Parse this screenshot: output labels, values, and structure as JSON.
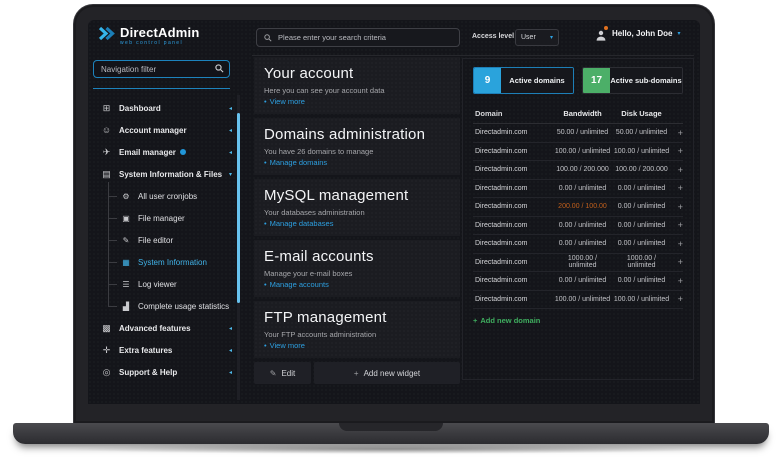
{
  "header": {
    "logo_title": "DirectAdmin",
    "logo_subtitle": "web control panel",
    "search_placeholder": "Please enter your search criteria",
    "access_level_label": "Access level",
    "access_level_value": "User",
    "greeting": "Hello, John Doe"
  },
  "sidebar": {
    "filter_placeholder": "Navigation filter",
    "top_items": [
      {
        "label": "Dashboard",
        "icon": "dashboard"
      },
      {
        "label": "Account manager",
        "icon": "account"
      },
      {
        "label": "Email manager",
        "icon": "email",
        "badge": true
      },
      {
        "label": "System Information & Files",
        "icon": "files",
        "expanded": true
      }
    ],
    "sub_items": [
      {
        "label": "All user cronjobs",
        "icon": "cronjobs"
      },
      {
        "label": "File manager",
        "icon": "folder"
      },
      {
        "label": "File editor",
        "icon": "editor"
      },
      {
        "label": "System Information",
        "icon": "sysinfo",
        "active": true
      },
      {
        "label": "Log viewer",
        "icon": "log"
      },
      {
        "label": "Complete usage statistics",
        "icon": "stats"
      }
    ],
    "bottom_items": [
      {
        "label": "Advanced features",
        "icon": "advanced"
      },
      {
        "label": "Extra features",
        "icon": "extra"
      },
      {
        "label": "Support & Help",
        "icon": "support"
      }
    ]
  },
  "widgets": [
    {
      "title": "Your account",
      "description": "Here you can see your account data",
      "link": "View more"
    },
    {
      "title": "Domains administration",
      "description": "You have 26 domains to manage",
      "link": "Manage domains"
    },
    {
      "title": "MySQL management",
      "description": "Your databases administration",
      "link": "Manage databases"
    },
    {
      "title": "E-mail accounts",
      "description": "Manage your e-mail boxes",
      "link": "Manage accounts"
    },
    {
      "title": "FTP management",
      "description": "Your FTP accounts administration",
      "link": "View more"
    }
  ],
  "widget_actions": {
    "edit_label": "Edit",
    "add_widget_label": "Add new widget"
  },
  "domains_panel": {
    "stats": [
      {
        "count": "9",
        "label": "Active domains",
        "color": "#2aa3dc",
        "active": true
      },
      {
        "count": "17",
        "label": "Active sub-domains",
        "color": "#4caf68"
      }
    ],
    "table_headers": [
      "Domain",
      "Bandwidth",
      "Disk Usage"
    ],
    "rows": [
      {
        "domain": "Directadmin.com",
        "bandwidth": "50.00 / unlimited",
        "disk": "50.00 / unlimited"
      },
      {
        "domain": "Directadmin.com",
        "bandwidth": "100.00 / unlimited",
        "disk": "100.00 / unlimited"
      },
      {
        "domain": "Directadmin.com",
        "bandwidth": "100.00 / 200.000",
        "disk": "100.00 / 200.000"
      },
      {
        "domain": "Directadmin.com",
        "bandwidth": "0.00 / unlimited",
        "disk": "0.00 / unlimited"
      },
      {
        "domain": "Directadmin.com",
        "bandwidth": "200.00 / 100.00",
        "disk": "0.00 / unlimited",
        "bandwidth_over": true
      },
      {
        "domain": "Directadmin.com",
        "bandwidth": "0.00 / unlimited",
        "disk": "0.00 / unlimited"
      },
      {
        "domain": "Directadmin.com",
        "bandwidth": "0.00 / unlimited",
        "disk": "0.00 / unlimited"
      },
      {
        "domain": "Directadmin.com",
        "bandwidth": "1000.00 / unlimited",
        "disk": "1000.00 / unlimited"
      },
      {
        "domain": "Directadmin.com",
        "bandwidth": "0.00 / unlimited",
        "disk": "0.00 / unlimited"
      },
      {
        "domain": "Directadmin.com",
        "bandwidth": "100.00 / unlimited",
        "disk": "100.00 / unlimited"
      }
    ],
    "over_limit_color": "#c2601c",
    "add_domain_label": "Add new domain"
  }
}
